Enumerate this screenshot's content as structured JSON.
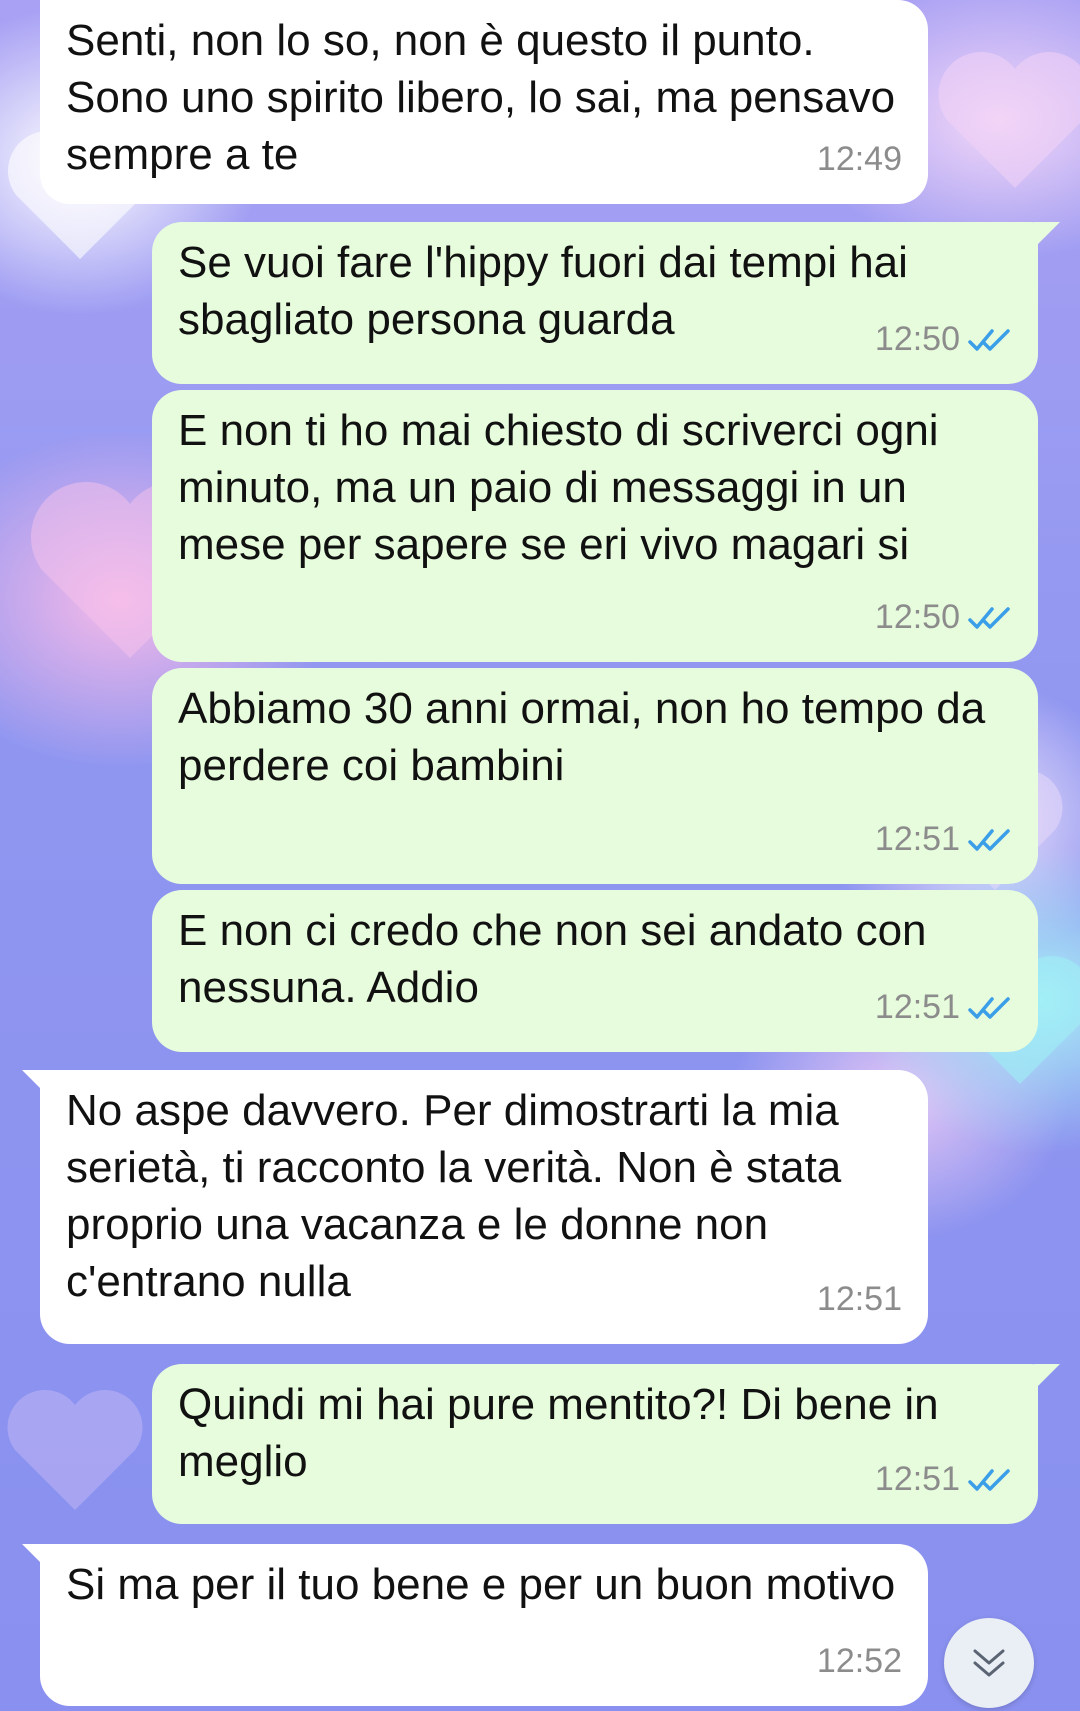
{
  "messages": [
    {
      "direction": "incoming",
      "text": "Senti, non lo so, non è questo il punto. Sono uno spirito libero, lo sai, ma pensavo sempre a te",
      "time": "12:49"
    },
    {
      "direction": "outgoing",
      "text": "Se vuoi fare l'hippy fuori dai tempi hai sbagliato persona guarda",
      "time": "12:50",
      "status": "read"
    },
    {
      "direction": "outgoing",
      "text": "E non ti ho mai chiesto di scriverci ogni minuto, ma un paio di messaggi in un mese per sapere se eri vivo magari si",
      "time": "12:50",
      "status": "read"
    },
    {
      "direction": "outgoing",
      "text": "Abbiamo 30 anni ormai, non ho tempo da perdere coi bambini",
      "time": "12:51",
      "status": "read"
    },
    {
      "direction": "outgoing",
      "text": "E non ci credo che non sei andato con nessuna. Addio",
      "time": "12:51",
      "status": "read"
    },
    {
      "direction": "incoming",
      "text": "No aspe davvero. Per dimostrarti la mia serietà, ti racconto la verità. Non è stata proprio una vacanza e le donne non c'entrano nulla",
      "time": "12:51"
    },
    {
      "direction": "outgoing",
      "text": "Quindi mi hai pure mentito?! Di bene in meglio",
      "time": "12:51",
      "status": "read"
    },
    {
      "direction": "incoming",
      "text": "Si ma per il tuo bene e per un buon motivo",
      "time": "12:52"
    }
  ],
  "icons": {
    "read_receipt": "double-check-icon",
    "scroll_down": "chevron-double-down-icon"
  },
  "colors": {
    "incoming_bubble": "#ffffff",
    "outgoing_bubble": "#e7fcdc",
    "read_tick": "#3b9ee8",
    "time_text": "#8c8c8c"
  }
}
